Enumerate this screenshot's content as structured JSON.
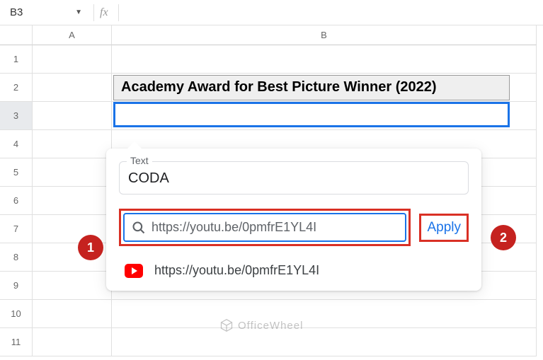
{
  "namebox": {
    "value": "B3"
  },
  "fx": {
    "label": "fx",
    "value": ""
  },
  "columns": {
    "a": "A",
    "b": "B"
  },
  "rows": [
    "1",
    "2",
    "3",
    "4",
    "5",
    "6",
    "7",
    "8",
    "9",
    "10",
    "11"
  ],
  "cells": {
    "b2": "Academy Award for Best Picture Winner (2022)"
  },
  "popup": {
    "text_label": "Text",
    "text_value": "CODA",
    "link_value": "https://youtu.be/0pmfrE1YL4I",
    "apply_label": "Apply",
    "suggestion": "https://youtu.be/0pmfrE1YL4I"
  },
  "callouts": {
    "one": "1",
    "two": "2"
  },
  "watermark": "OfficeWheel"
}
